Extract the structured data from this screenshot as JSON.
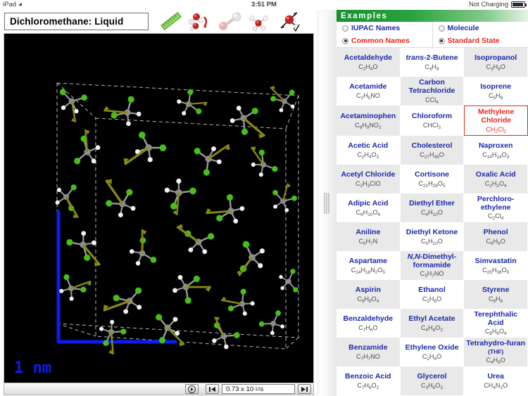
{
  "statusbar": {
    "device": "iPad",
    "wifi_icon": "wifi-icon",
    "time": "3:51 PM",
    "battery_label": "Not Charging",
    "battery_icon": "battery-icon"
  },
  "toolbar": {
    "title_value": "Dichloromethane: Liquid",
    "title_placeholder": "Molecule: State",
    "icons": [
      {
        "name": "ruler-icon",
        "label": "Measure"
      },
      {
        "name": "molecules-arrow-icon",
        "label": "Molecules"
      },
      {
        "name": "bond-dumbbell-icon",
        "label": "Bond"
      },
      {
        "name": "small-molecule-icon",
        "label": "Single Molecule"
      },
      {
        "name": "molecule-vector-check-icon",
        "label": "Velocity Vectors"
      }
    ]
  },
  "simulation": {
    "scale_label": "1  nm",
    "axis_color": "#0b1ef0",
    "background": "#000000",
    "box_line_color": "#d8d8d8",
    "atom_colors": {
      "chlorine": "#46c016",
      "carbon": "#a0a0a0",
      "hydrogen": "#ffffff",
      "velocity_arrow": "#8a8a12"
    }
  },
  "playback": {
    "play_icon": "play-icon",
    "step_back_icon": "step-back-icon",
    "step_forward_icon": "step-forward-icon",
    "time_value": "0.73 x 10",
    "time_exponent": "-12",
    "time_unit": " s"
  },
  "splitter": {
    "name": "pane-splitter",
    "grip_icon": "grip-lines-icon"
  },
  "examples": {
    "header": "Examples",
    "options": [
      {
        "label": "IUPAC Names",
        "selected": false
      },
      {
        "label": "Molecule",
        "selected": false
      },
      {
        "label": "Common Names",
        "selected": true
      },
      {
        "label": "Standard State",
        "selected": true
      }
    ],
    "selected_molecule": "Methylene Chloride",
    "molecules": [
      {
        "name": "Acetaldehyde",
        "formula": "C2H4O",
        "shade": true,
        "selected": false
      },
      {
        "name": "trans-2-Butene",
        "formula": "C4H8",
        "shade": false,
        "selected": false,
        "italic_prefix": "trans"
      },
      {
        "name": "Isopropanol",
        "formula": "C3H8O",
        "shade": true,
        "selected": false
      },
      {
        "name": "Acetamide",
        "formula": "C2H5NO",
        "shade": false,
        "selected": false
      },
      {
        "name": "Carbon Tetrachloride",
        "formula": "CCl4",
        "shade": true,
        "selected": false
      },
      {
        "name": "Isoprene",
        "formula": "C5H8",
        "shade": false,
        "selected": false
      },
      {
        "name": "Acetaminophen",
        "formula": "C8H9NO2",
        "shade": true,
        "selected": false
      },
      {
        "name": "Chloroform",
        "formula": "CHCl3",
        "shade": false,
        "selected": false
      },
      {
        "name": "Methylene Chloride",
        "formula": "CH2Cl2",
        "shade": false,
        "selected": true
      },
      {
        "name": "Acetic Acid",
        "formula": "C2H4O2",
        "shade": false,
        "selected": false
      },
      {
        "name": "Cholesterol",
        "formula": "C27H46O",
        "shade": true,
        "selected": false
      },
      {
        "name": "Naproxen",
        "formula": "C14H14O3",
        "shade": false,
        "selected": false
      },
      {
        "name": "Acetyl Chloride",
        "formula": "C2H3ClO",
        "shade": true,
        "selected": false
      },
      {
        "name": "Cortisone",
        "formula": "C21H28O5",
        "shade": false,
        "selected": false
      },
      {
        "name": "Oxalic Acid",
        "formula": "C2H2O4",
        "shade": true,
        "selected": false
      },
      {
        "name": "Adipic Acid",
        "formula": "C6H10O4",
        "shade": false,
        "selected": false
      },
      {
        "name": "Diethyl Ether",
        "formula": "C4H10O",
        "shade": true,
        "selected": false
      },
      {
        "name": "Perchloro-ethylene",
        "formula": "C2Cl4",
        "shade": false,
        "selected": false
      },
      {
        "name": "Aniline",
        "formula": "C6H7N",
        "shade": true,
        "selected": false
      },
      {
        "name": "Diethyl Ketone",
        "formula": "C5H10O",
        "shade": false,
        "selected": false
      },
      {
        "name": "Phenol",
        "formula": "C6H6O",
        "shade": true,
        "selected": false
      },
      {
        "name": "Aspartame",
        "formula": "C14H18N2O5",
        "shade": false,
        "selected": false
      },
      {
        "name": "N,N-Dimethyl-formamide",
        "formula": "C3H7NO",
        "shade": true,
        "selected": false,
        "italic_prefix": "N,N"
      },
      {
        "name": "Simvastatin",
        "formula": "C25H38O5",
        "shade": false,
        "selected": false
      },
      {
        "name": "Aspirin",
        "formula": "C9H8O4",
        "shade": true,
        "selected": false
      },
      {
        "name": "Ethanol",
        "formula": "C2H6O",
        "shade": false,
        "selected": false
      },
      {
        "name": "Styrene",
        "formula": "C8H8",
        "shade": true,
        "selected": false
      },
      {
        "name": "Benzaldehyde",
        "formula": "C7H6O",
        "shade": false,
        "selected": false
      },
      {
        "name": "Ethyl Acetate",
        "formula": "C4H8O2",
        "shade": true,
        "selected": false
      },
      {
        "name": "Terephthalic Acid",
        "formula": "C8H6O4",
        "shade": false,
        "selected": false
      },
      {
        "name": "Benzamide",
        "formula": "C7H7NO",
        "shade": true,
        "selected": false
      },
      {
        "name": "Ethylene Oxide",
        "formula": "C2H4O",
        "shade": false,
        "selected": false
      },
      {
        "name": "Tetrahydro-furan (THF)",
        "formula": "C4H8O",
        "shade": true,
        "selected": false,
        "small_suffix": "(THF)"
      },
      {
        "name": "Benzoic Acid",
        "formula": "C7H6O2",
        "shade": false,
        "selected": false
      },
      {
        "name": "Glycerol",
        "formula": "C3H8O3",
        "shade": true,
        "selected": false
      },
      {
        "name": "Urea",
        "formula": "CH4N2O",
        "shade": false,
        "selected": false
      }
    ]
  }
}
